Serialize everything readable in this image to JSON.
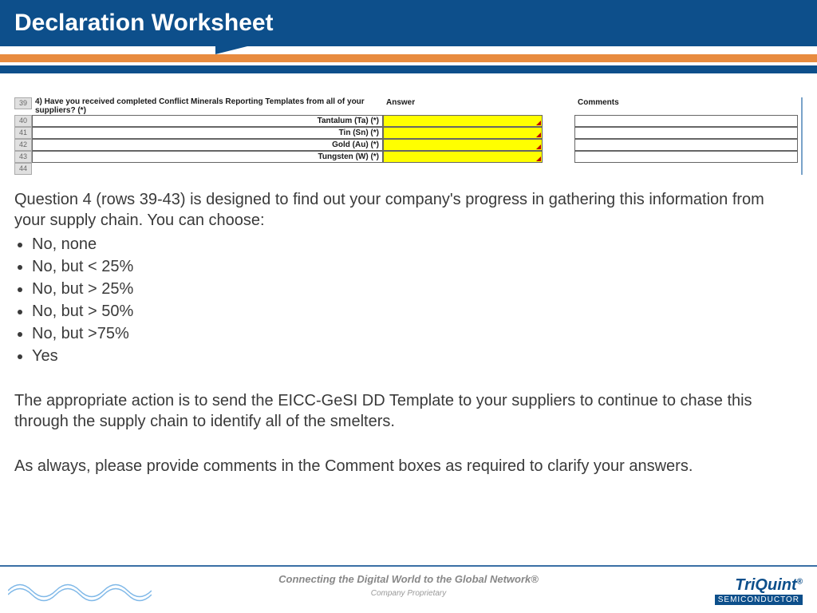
{
  "header": {
    "title": "Declaration Worksheet"
  },
  "sheet": {
    "question": "4) Have you received completed Conflict Minerals Reporting Templates from all of your suppliers? (*)",
    "answer_header": "Answer",
    "comments_header": "Comments",
    "rows": [
      {
        "num": "39"
      },
      {
        "num": "40",
        "label": "Tantalum (Ta) (*)"
      },
      {
        "num": "41",
        "label": "Tin (Sn) (*)"
      },
      {
        "num": "42",
        "label": "Gold (Au) (*)"
      },
      {
        "num": "43",
        "label": "Tungsten (W) (*)"
      },
      {
        "num": "44"
      }
    ]
  },
  "body": {
    "intro": "Question 4 (rows 39-43) is designed to find out your company's progress in gathering this information from your supply chain.  You can choose:",
    "options": [
      "No, none",
      "No, but < 25%",
      "No, but > 25%",
      "No, but > 50%",
      "No, but >75%",
      "Yes"
    ],
    "para2": "The appropriate action is to send the EICC-GeSI DD Template to your suppliers to continue to chase this through the supply chain to identify all of the smelters.",
    "para3": "As always, please provide comments in the Comment boxes as required to clarify your answers."
  },
  "footer": {
    "tagline": "Connecting the Digital World to the Global Network®",
    "proprietary": "Company Proprietary",
    "logo_top": "TriQuint",
    "logo_r": "®",
    "logo_bottom": "SEMICONDUCTOR"
  }
}
